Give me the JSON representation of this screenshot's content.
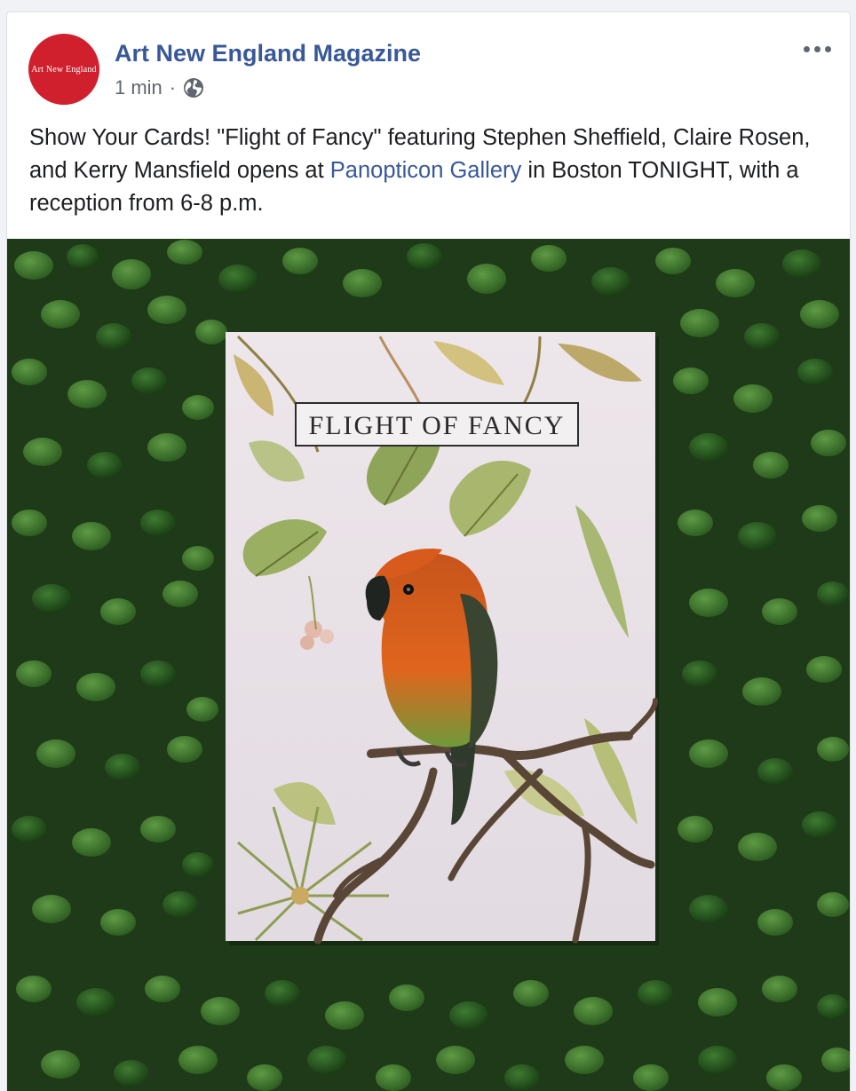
{
  "post": {
    "page_name": "Art New England Magazine",
    "avatar_text": "Art New England",
    "timestamp": "1 min",
    "separator": "·",
    "privacy_icon": "globe-icon",
    "more_icon": "more-options-icon",
    "text_part1": "Show Your Cards! \"Flight of Fancy\" featuring Stephen Sheffield, Claire Rosen, and Kerry Mansfield opens at ",
    "text_link": "Panopticon Gallery",
    "text_part2": " in Boston TONIGHT, with a reception from 6-8 p.m."
  },
  "photo": {
    "card_title": "FLIGHT OF FANCY"
  },
  "colors": {
    "link": "#385898",
    "avatar_bg": "#d0202e",
    "text": "#1c1e21",
    "meta": "#606770"
  }
}
